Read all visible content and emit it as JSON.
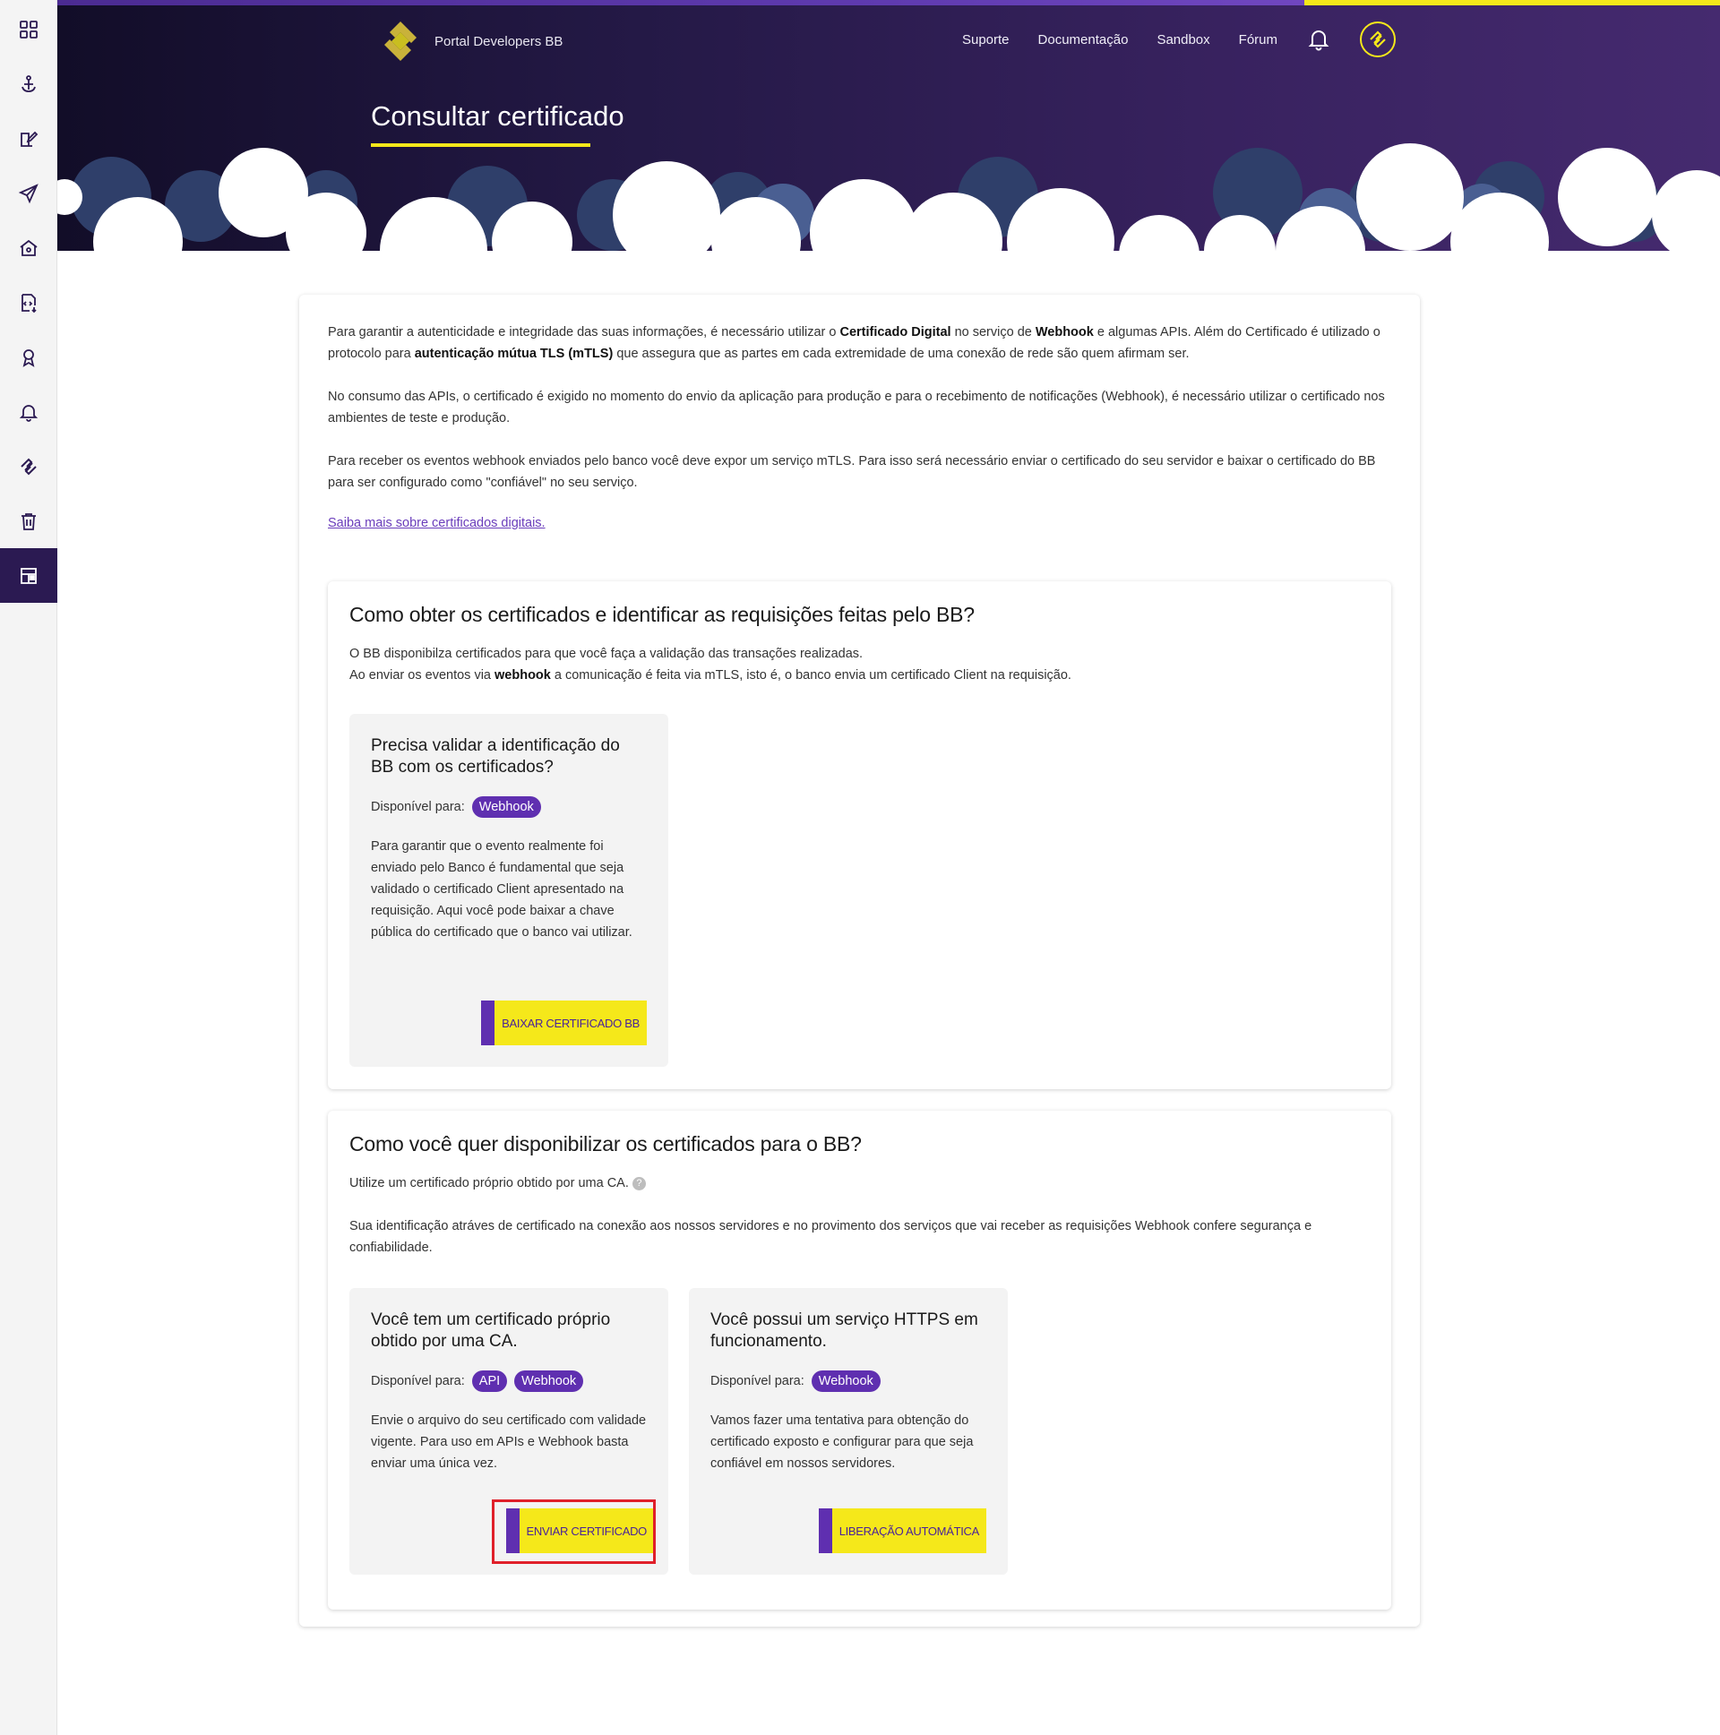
{
  "colors": {
    "brand_purple": "#5f2fb0",
    "brand_yellow": "#f5e81a",
    "header_dark": "#1c1438",
    "highlight_red": "#e0202a"
  },
  "sidebar": {
    "items": [
      {
        "icon": "grid-icon"
      },
      {
        "icon": "anchor-icon"
      },
      {
        "icon": "edit-icon"
      },
      {
        "icon": "send-icon"
      },
      {
        "icon": "home-icon"
      },
      {
        "icon": "code-file-icon"
      },
      {
        "icon": "award-icon"
      },
      {
        "icon": "bell-icon"
      },
      {
        "icon": "bb-logo-icon"
      },
      {
        "icon": "trash-icon"
      },
      {
        "icon": "dashboard-icon",
        "active": true
      }
    ]
  },
  "header": {
    "logo_text": "Portal Developers BB",
    "nav": [
      "Suporte",
      "Documentação",
      "Sandbox",
      "Fórum"
    ],
    "page_title": "Consultar certificado"
  },
  "intro": {
    "p1_a": "Para garantir a autenticidade e integridade das suas informações, é necessário utilizar o ",
    "p1_b": "Certificado Digital",
    "p1_c": " no serviço de ",
    "p1_d": "Webhook",
    "p1_e": " e algumas APIs. Além do Certificado é utilizado o protocolo para ",
    "p1_f": "autenticação mútua TLS (mTLS)",
    "p1_g": " que assegura que as partes em cada extremidade de uma conexão de rede são quem afirmam ser.",
    "p2": "No consumo das APIs, o certificado é exigido no momento do envio da aplicação para produção e para o recebimento de notificações (Webhook), é necessário utilizar o certificado nos ambientes de teste e produção.",
    "p3": "Para receber os eventos webhook enviados pelo banco você deve expor um serviço mTLS. Para isso será necessário enviar o certificado do seu servidor e baixar o certificado do BB para ser configurado como \"confiável\" no seu serviço.",
    "link": "Saiba mais sobre certificados digitais."
  },
  "section1": {
    "title": "Como obter os certificados e identificar as requisições feitas pelo BB?",
    "line1": "O BB disponibilza certificados para que você faça a validação das transações realizadas.",
    "line2_a": "Ao enviar os eventos via ",
    "line2_b": "webhook",
    "line2_c": " a comunicação é feita via mTLS, isto é, o banco envia um certificado Client na requisição.",
    "card": {
      "title": "Precisa validar a identificação do BB com os certificados?",
      "avail_label": "Disponível para:",
      "tags": [
        "Webhook"
      ],
      "text": "Para garantir que o evento realmente foi enviado pelo Banco é fundamental que seja validado o certificado Client apresentado na requisição. Aqui você pode baixar a chave pública do certificado que o banco vai utilizar.",
      "button": "BAIXAR CERTIFICADO BB"
    }
  },
  "section2": {
    "title": "Como você quer disponibilizar os certificados para o BB?",
    "line1": "Utilize um certificado próprio obtido por uma CA.",
    "help": "?",
    "line2": "Sua identificação atráves de certificado na conexão aos nossos servidores e no provimento dos serviços que vai receber as requisições Webhook confere segurança e confiabilidade.",
    "card1": {
      "title": "Você tem um certificado próprio obtido por uma CA.",
      "avail_label": "Disponível para:",
      "tags": [
        "API",
        "Webhook"
      ],
      "text": "Envie o arquivo do seu certificado com validade vigente. Para uso em APIs e Webhook basta enviar uma única vez.",
      "button": "ENVIAR CERTIFICADO"
    },
    "card2": {
      "title": "Você possui um serviço HTTPS em funcionamento.",
      "avail_label": "Disponível para:",
      "tags": [
        "Webhook"
      ],
      "text": "Vamos fazer uma tentativa para obtenção do certificado exposto e configurar para que seja confiável em nossos servidores.",
      "button": "LIBERAÇÃO AUTOMÁTICA"
    }
  }
}
